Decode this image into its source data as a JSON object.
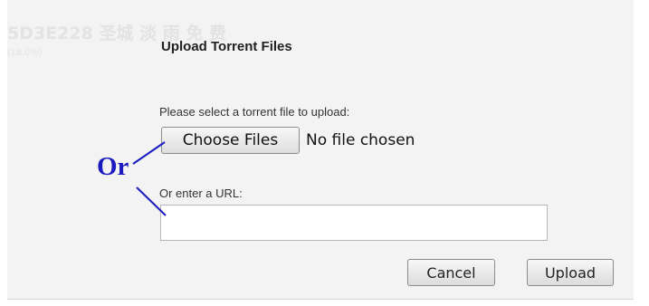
{
  "background_ghost": {
    "title": "5D3E228 圣城 淡 雨 免 费",
    "subtitle": "(18.0%)"
  },
  "dialog": {
    "title": "Upload Torrent Files",
    "select_prompt": "Please select a torrent file to upload:",
    "choose_button_label": "Choose Files",
    "file_status": "No file chosen",
    "url_prompt": "Or enter a URL:",
    "url_value": "",
    "url_placeholder": "",
    "cancel_label": "Cancel",
    "upload_label": "Upload"
  },
  "annotation": {
    "label": "Or",
    "color": "#1b1bbf"
  }
}
